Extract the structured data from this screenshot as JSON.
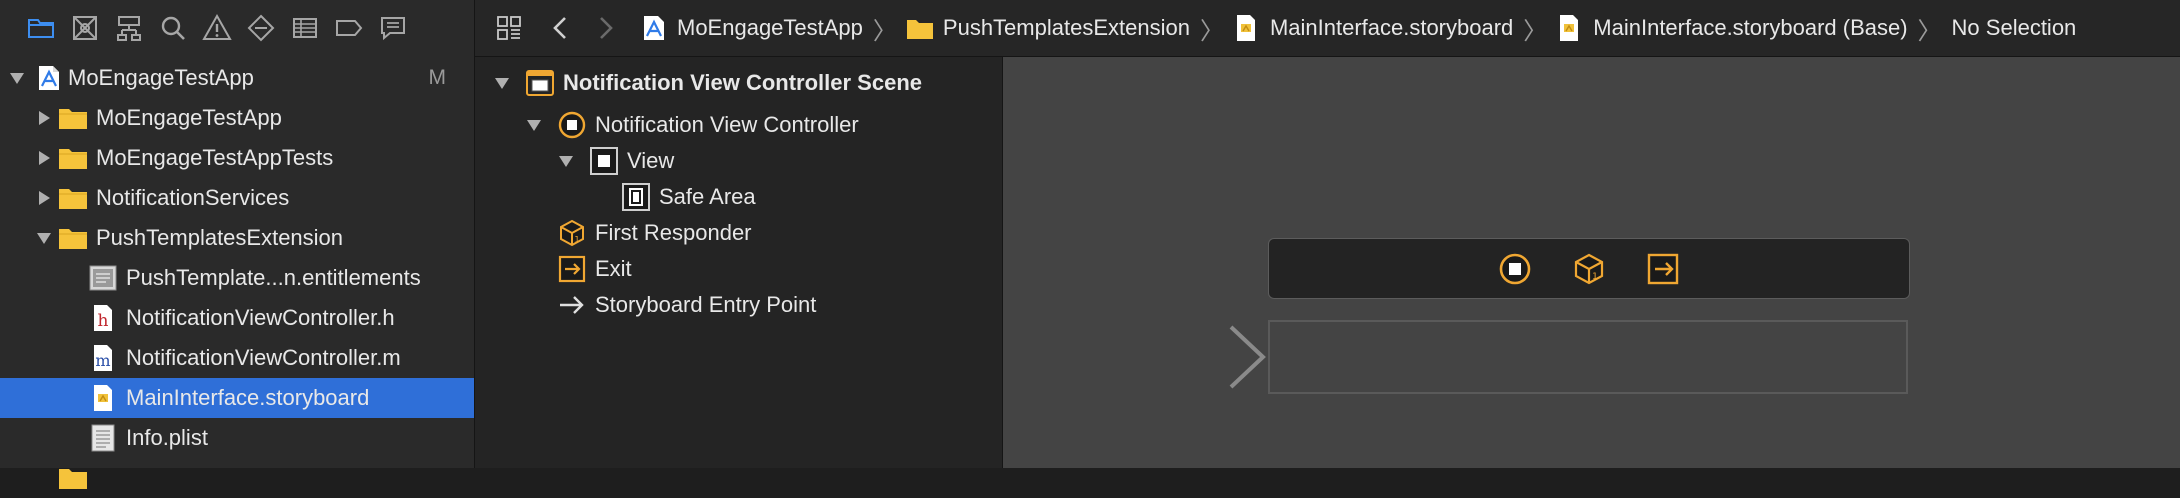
{
  "navigator": {
    "toolbar": [
      {
        "name": "project-navigator-icon",
        "active": true
      },
      {
        "name": "source-control-icon"
      },
      {
        "name": "symbol-navigator-icon"
      },
      {
        "name": "find-navigator-icon"
      },
      {
        "name": "issue-navigator-icon"
      },
      {
        "name": "test-navigator-icon"
      },
      {
        "name": "debug-navigator-icon"
      },
      {
        "name": "breakpoint-navigator-icon"
      },
      {
        "name": "report-navigator-icon"
      }
    ],
    "tree": [
      {
        "label": "MoEngageTestApp",
        "badge": "M",
        "level": 0,
        "expanded": true,
        "icon": "xcode-project-icon"
      },
      {
        "label": "MoEngageTestApp",
        "level": 1,
        "expanded": false,
        "icon": "folder-icon"
      },
      {
        "label": "MoEngageTestAppTests",
        "level": 1,
        "expanded": false,
        "icon": "folder-icon"
      },
      {
        "label": "NotificationServices",
        "level": 1,
        "expanded": false,
        "icon": "folder-icon"
      },
      {
        "label": "PushTemplatesExtension",
        "level": 1,
        "expanded": true,
        "icon": "folder-icon"
      },
      {
        "label": "PushTemplate...n.entitlements",
        "level": 2,
        "icon": "entitlements-file-icon"
      },
      {
        "label": "NotificationViewController.h",
        "level": 2,
        "icon": "header-file-icon"
      },
      {
        "label": "NotificationViewController.m",
        "level": 2,
        "icon": "objc-file-icon"
      },
      {
        "label": "MainInterface.storyboard",
        "level": 2,
        "icon": "storyboard-file-icon",
        "selected": true
      },
      {
        "label": "Info.plist",
        "level": 2,
        "icon": "plist-file-icon"
      }
    ]
  },
  "jumpbar": {
    "crumbs": [
      {
        "label": "MoEngageTestApp",
        "icon": "xcode-project-icon"
      },
      {
        "label": "PushTemplatesExtension",
        "icon": "folder-icon"
      },
      {
        "label": "MainInterface.storyboard",
        "icon": "storyboard-file-icon"
      },
      {
        "label": "MainInterface.storyboard (Base)",
        "icon": "storyboard-file-icon"
      },
      {
        "label": "No Selection",
        "icon": ""
      }
    ]
  },
  "outline": {
    "items": [
      {
        "label": "Notification View Controller Scene",
        "bold": true,
        "icon": "scene-icon",
        "disclosure": "open"
      },
      {
        "label": "Notification View Controller",
        "icon": "view-controller-icon",
        "disclosure": "open"
      },
      {
        "label": "View",
        "icon": "view-icon",
        "disclosure": "open"
      },
      {
        "label": "Safe Area",
        "icon": "safe-area-icon",
        "disclosure": "none"
      },
      {
        "label": "First Responder",
        "icon": "first-responder-icon",
        "disclosure": "none"
      },
      {
        "label": "Exit",
        "icon": "exit-icon",
        "disclosure": "none"
      },
      {
        "label": "Storyboard Entry Point",
        "icon": "entry-arrow-icon",
        "disclosure": "none"
      }
    ]
  },
  "colors": {
    "selection": "#2f6fd8",
    "folder": "#f5c33b",
    "accent_orange": "#f0a732"
  }
}
